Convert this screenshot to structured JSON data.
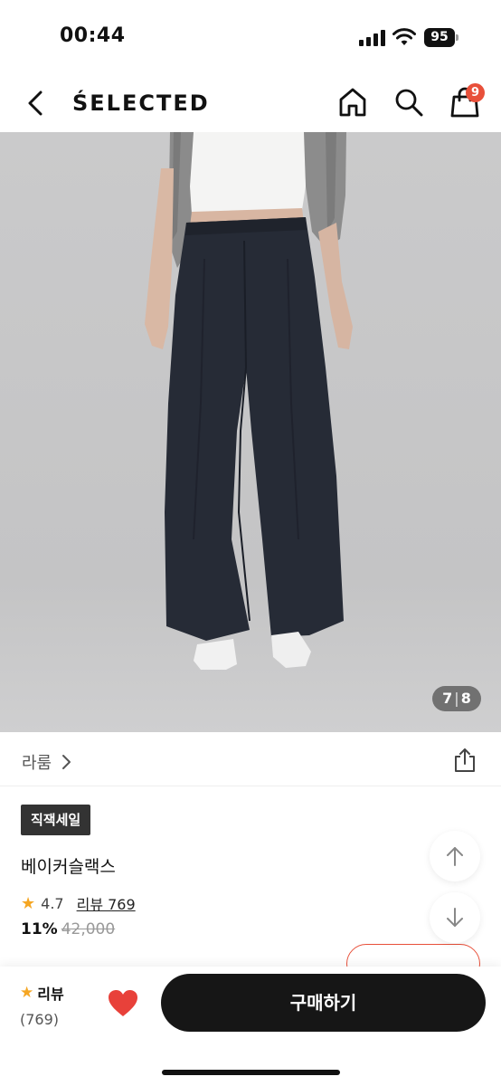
{
  "status_bar": {
    "time": "00:44",
    "battery": "95"
  },
  "header": {
    "brand": "ŚELECTED",
    "cart_count": "9"
  },
  "gallery": {
    "current": "7",
    "separator": "|",
    "total": "8"
  },
  "brand_row": {
    "name": "라룸"
  },
  "product": {
    "badge": "직잭세일",
    "name": "베이커슬랙스",
    "rating": "4.7",
    "review_link": "리뷰 769",
    "discount": "11%",
    "original_price": "42,000"
  },
  "bottom_bar": {
    "review_label": "리뷰",
    "review_count": "(769)",
    "buy_label": "구매하기"
  },
  "colors": {
    "accent": "#e8503a",
    "star": "#f5a623",
    "buy_button": "#161616"
  }
}
